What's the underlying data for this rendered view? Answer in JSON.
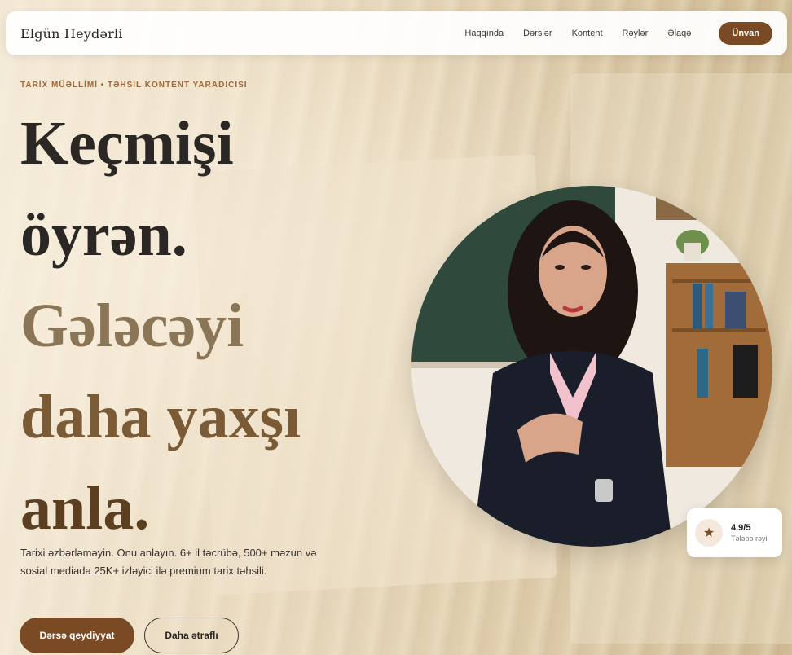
{
  "nav": {
    "brand": "Elgün Heydərli",
    "links": [
      "Haqqında",
      "Dərslər",
      "Kontent",
      "Rəylər",
      "Əlaqə"
    ],
    "cta": "Ünvan"
  },
  "hero": {
    "eyebrow": "TARİX MÜƏLLİMİ • TƏHSİL KONTENT YARADICISI",
    "headline": [
      "Keçmişi",
      "öyrən.",
      "Gələcəyi",
      "daha yaxşı",
      "anla."
    ],
    "lede": "Tarixi əzbərləməyin. Onu anlayın. 6+ il təcrübə, 500+ məzun və sosial mediada 25K+ izləyici ilə premium tarix təhsili.",
    "primary_button": "Dərsə qeydiyyat",
    "secondary_button": "Daha ətraflı"
  },
  "rating": {
    "score": "4.9/5",
    "label": "Tələbə rəyi",
    "icon": "star-icon"
  },
  "colors": {
    "accent": "#7a4a24",
    "eyebrow": "#a0673a"
  }
}
